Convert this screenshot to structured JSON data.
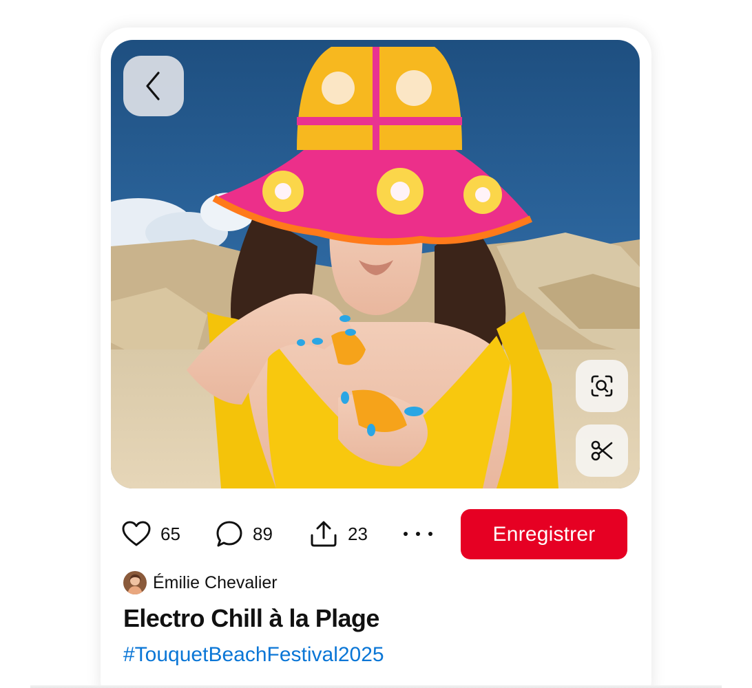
{
  "pin": {
    "photo_alt": "",
    "likes": "65",
    "comments": "89",
    "shares": "23",
    "save_label": "Enregistrer",
    "author": {
      "name": "Émilie Chevalier"
    },
    "title": "Electro Chill à la Plage",
    "hashtag": "#TouquetBeachFestival2025"
  },
  "icons": {
    "back": "chevron-left-icon",
    "lens": "visual-search-icon",
    "cut": "scissors-icon",
    "like": "heart-icon",
    "comment": "comment-bubble-icon",
    "share": "share-upload-icon",
    "more": "more-dots-icon"
  },
  "colors": {
    "save_button": "#e60023",
    "hashtag": "#0a76d6",
    "text": "#111111"
  }
}
